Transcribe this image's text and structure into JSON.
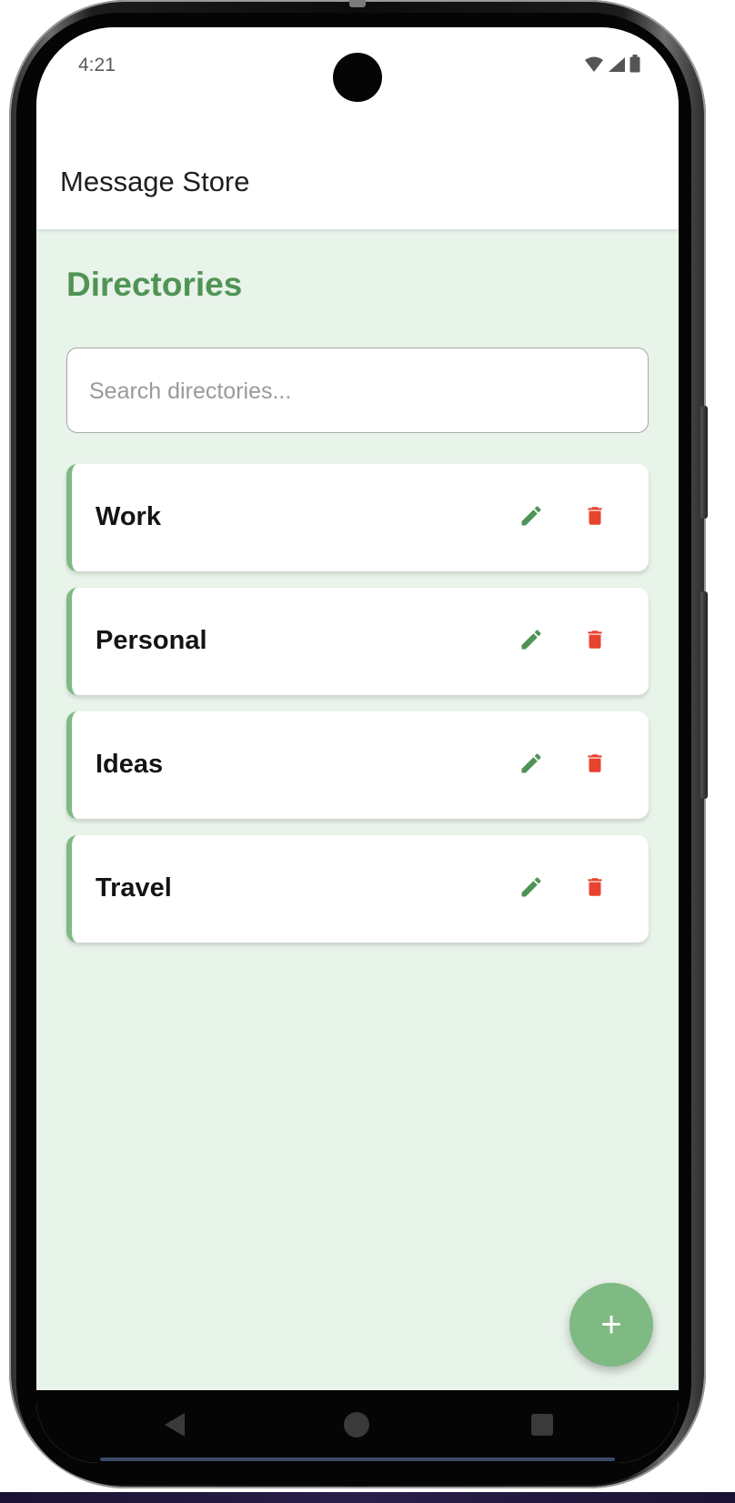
{
  "status_bar": {
    "time": "4:21",
    "icons": [
      "wifi-icon",
      "cellular-signal-icon",
      "battery-icon"
    ]
  },
  "app_bar": {
    "title": "Message Store"
  },
  "page": {
    "title": "Directories"
  },
  "search": {
    "placeholder": "Search directories...",
    "value": ""
  },
  "directories": [
    {
      "name": "Work",
      "edit_icon": "pencil-icon",
      "delete_icon": "trash-icon"
    },
    {
      "name": "Personal",
      "edit_icon": "pencil-icon",
      "delete_icon": "trash-icon"
    },
    {
      "name": "Ideas",
      "edit_icon": "pencil-icon",
      "delete_icon": "trash-icon"
    },
    {
      "name": "Travel",
      "edit_icon": "pencil-icon",
      "delete_icon": "trash-icon"
    }
  ],
  "fab": {
    "label": "+",
    "icon": "plus-icon"
  },
  "navigation_bar": {
    "buttons": [
      "back-icon",
      "home-icon",
      "recents-icon"
    ]
  },
  "colors": {
    "accent_green": "#4f9455",
    "card_border_green": "#7fb983",
    "edit_icon_green": "#4f9455",
    "delete_icon_red": "#e8432e",
    "background": "#e8f3ea",
    "fab_color": "#7fb983"
  }
}
